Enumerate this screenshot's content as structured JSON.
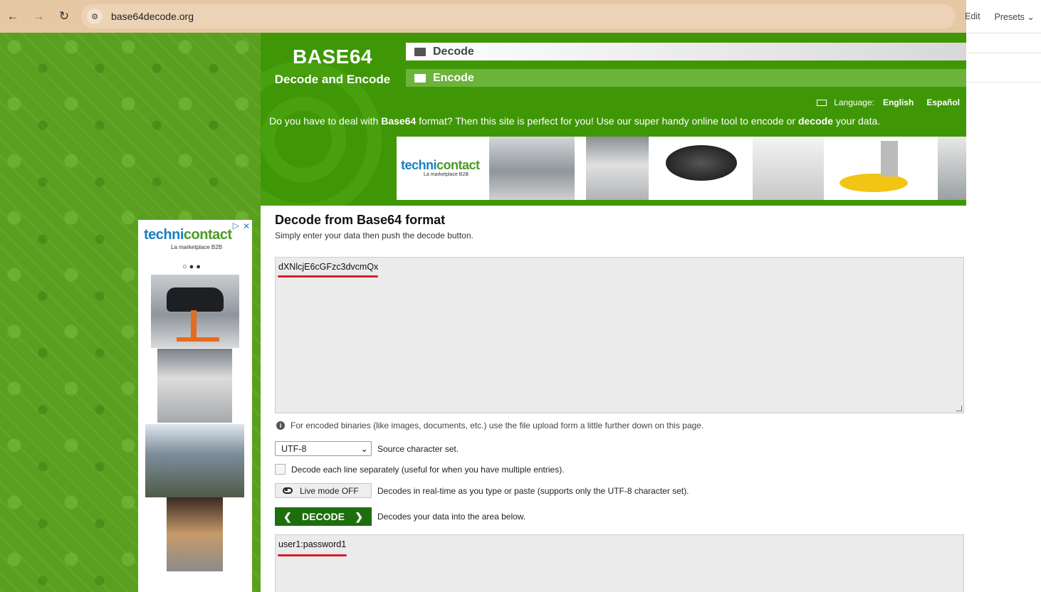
{
  "browser": {
    "back_icon": "←",
    "forward_icon": "→",
    "reload_icon": "↻",
    "site_info_icon": "⚙",
    "url": "base64decode.org"
  },
  "side_panel": {
    "edit": "Edit",
    "presets": "Presets ⌄"
  },
  "header": {
    "title": "BASE64",
    "subtitle": "Decode and Encode",
    "tabs": [
      {
        "label": "Decode",
        "active": true
      },
      {
        "label": "Encode",
        "active": false
      }
    ],
    "language_label": "Language:",
    "languages": [
      "English",
      "Español"
    ],
    "intro": {
      "part1": "Do you have to deal with ",
      "bold1": "Base64",
      "part2": " format? Then this site is perfect for you! Use our super handy online tool to encode or ",
      "bold2": "decode",
      "part3": " your data."
    }
  },
  "ads": {
    "brand_main": "techni",
    "brand_accent": "contact",
    "brand_tagline": "La marketplace B2B",
    "carousel_dots": "○●●",
    "ad_choices_icon": "▷",
    "close_icon": "✕"
  },
  "main": {
    "section_title": "Decode from Base64 format",
    "section_subtitle": "Simply enter your data then push the decode button.",
    "input_value": "dXNlcjE6cGFzc3dvcmQx",
    "info_icon": "i",
    "info_text": "For encoded binaries (like images, documents, etc.) use the file upload form a little further down on this page.",
    "charset_selected": "UTF-8",
    "charset_desc": "Source character set.",
    "each_line_label": "Decode each line separately (useful for when you have multiple entries).",
    "live_mode_label": "Live mode OFF",
    "live_mode_desc": "Decodes in real-time as you type or paste (supports only the UTF-8 character set).",
    "decode_button": "DECODE",
    "decode_left_icon": "❮",
    "decode_right_icon": "❯",
    "decode_desc": "Decodes your data into the area below.",
    "output_value": "user1:password1"
  },
  "colors": {
    "header_green": "#3f9707",
    "decode_button": "#1e6e0e",
    "underline_red": "#d41f2a",
    "browser_bar": "#e6c8a5"
  }
}
